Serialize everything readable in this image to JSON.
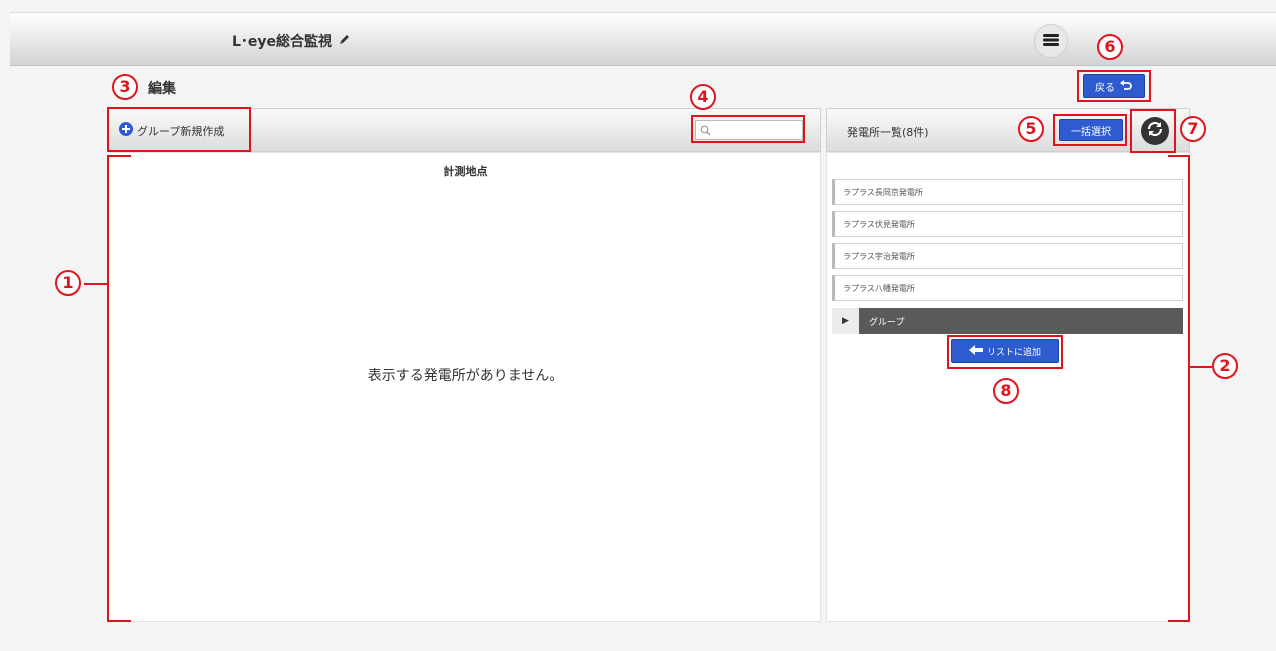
{
  "header": {
    "title": "L･eye総合監視",
    "edit_icon": "pencil-icon",
    "menu_icon": "hamburger-menu-icon"
  },
  "page": {
    "title": "編集",
    "back_label": "戻る"
  },
  "left_panel": {
    "new_group_label": "グループ新規作成",
    "search_placeholder": "",
    "column_header": "計測地点",
    "empty_message": "表示する発電所がありません。"
  },
  "right_panel": {
    "count_label": "発電所一覧(8件)",
    "bulk_select_label": "一括選択",
    "plants": [
      {
        "name": "ラプラス長岡京発電所"
      },
      {
        "name": "ラプラス伏見発電所"
      },
      {
        "name": "ラプラス宇治発電所"
      },
      {
        "name": "ラプラス八幡発電所"
      }
    ],
    "group_label": "グループ",
    "add_to_list_label": "リストに追加"
  },
  "annotations": [
    "1",
    "2",
    "3",
    "4",
    "5",
    "6",
    "7",
    "8"
  ],
  "colors": {
    "accent_blue": "#2e5bd0",
    "annotation_red": "#e0141e",
    "group_bar": "#5a5a5a"
  }
}
